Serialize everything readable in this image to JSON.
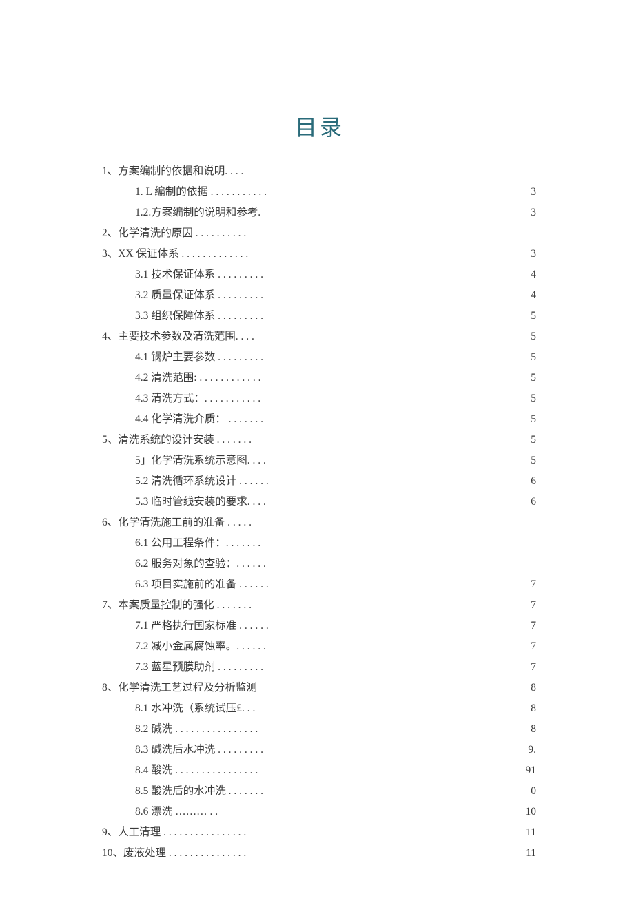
{
  "title": "目录",
  "entries": [
    {
      "text": "1、方案编制的依据和说明. . . .",
      "sub": false
    },
    {
      "text": "1. L 编制的依据 . . . . . . . . . . .",
      "sub": true
    },
    {
      "text": "1.2.方案编制的说明和参考.",
      "sub": true
    },
    {
      "text": "2、化学清洗的原因 . . . . . . . . . .",
      "sub": false
    },
    {
      "text": "3、XX 保证体系 . . . . . . . . . . . . .",
      "sub": false
    },
    {
      "text": "3.1 技术保证体系 . . . . . . . . .",
      "sub": true
    },
    {
      "text": "3.2 质量保证体系 . . . . . . . . .",
      "sub": true
    },
    {
      "text": "3.3 组织保障体系 . . . . . . . . .",
      "sub": true
    },
    {
      "text": "4、主要技术参数及清洗范围. . . .",
      "sub": false
    },
    {
      "text": "4.1 锅炉主要参数 . . . . . . . . .",
      "sub": true
    },
    {
      "text": "4.2 清洗范围: . . . . . . . . . . . .",
      "sub": true
    },
    {
      "text": "4.3 清洗方式：. . . . . . . . . . .",
      "sub": true
    },
    {
      "text": "4.4 化学清洗介质： . . . . . . .",
      "sub": true
    },
    {
      "text": "5、清洗系统的设计安装 . . . . . . .",
      "sub": false
    },
    {
      "text": "5」化学清洗系统示意图. . . .",
      "sub": true
    },
    {
      "text": "5.2 清洗循环系统设计 . . . . . .",
      "sub": true
    },
    {
      "text": "5.3 临时管线安装的要求. . . .",
      "sub": true
    },
    {
      "text": "6、化学清洗施工前的准备 . . . . .",
      "sub": false
    },
    {
      "text": "6.1 公用工程条件：. . . . . . .",
      "sub": true
    },
    {
      "text": "6.2 服务对象的查验：. . . . . .",
      "sub": true
    },
    {
      "text": "6.3 项目实施前的准备 . . . . . .",
      "sub": true
    },
    {
      "text": "7、本案质量控制的强化 . . . . . . .",
      "sub": false
    },
    {
      "text": "7.1 严格执行国家标准 . . . . . .",
      "sub": true
    },
    {
      "text": "7.2 减小金属腐蚀率。. . . . . .",
      "sub": true
    },
    {
      "text": "7.3 蓝星预膜助剂 . . . . . . . . .",
      "sub": true
    },
    {
      "text": "8、化学清洗工艺过程及分析监测",
      "sub": false
    },
    {
      "text": "8.1 水冲洗（系统试压£. . .",
      "sub": true
    },
    {
      "text": "8.2 碱洗 . . . . . . . . . . . . . . . .",
      "sub": true
    },
    {
      "text": "8.3 碱洗后水冲洗 . . . . . . . . .",
      "sub": true
    },
    {
      "text": "8.4 酸洗 . . . . . . . . . . . . . . . .",
      "sub": true
    },
    {
      "text": "8.5 酸洗后的水冲洗 . . . . . . .",
      "sub": true
    },
    {
      "text": "8.6 漂洗 ……… . .",
      "sub": true
    },
    {
      "text": "9、人工清理 . . . . . . . . . . . . . . . .",
      "sub": false
    },
    {
      "text": "10、废液处理 . . . . . . . . . . . . . . .",
      "sub": false
    }
  ],
  "page_numbers": [
    "",
    "3",
    "3",
    "",
    "3",
    "4",
    "4",
    "5",
    "5",
    "5",
    "5",
    "5",
    "5",
    "5",
    "5",
    "6",
    "6",
    "",
    "",
    "",
    "7",
    "7",
    "7",
    "7",
    "7",
    "8",
    "8",
    "8",
    "9.",
    "91",
    "0",
    "10",
    "11",
    "11"
  ]
}
